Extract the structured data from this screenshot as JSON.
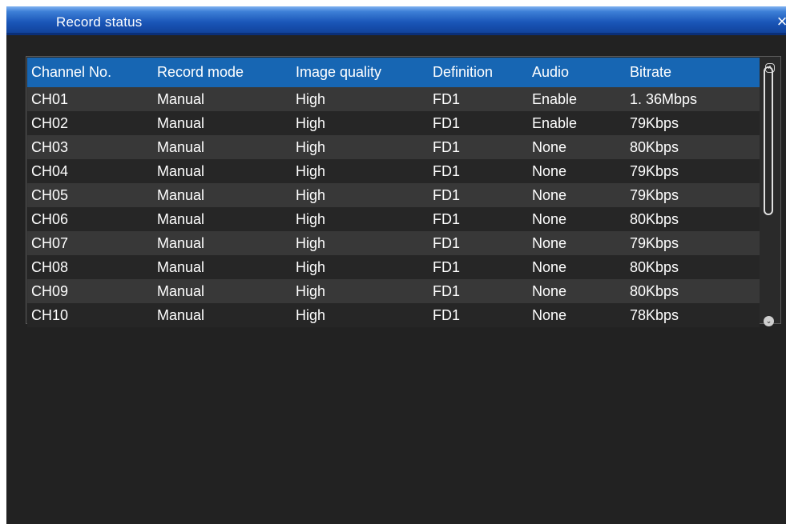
{
  "window": {
    "title": "Record status",
    "close_symbol": "×"
  },
  "table": {
    "headers": [
      "Channel No.",
      "Record mode",
      "Image quality",
      "Definition",
      "Audio",
      "Bitrate"
    ],
    "rows": [
      [
        "CH01",
        "Manual",
        "High",
        "FD1",
        "Enable",
        "1. 36Mbps"
      ],
      [
        "CH02",
        "Manual",
        "High",
        "FD1",
        "Enable",
        "79Kbps"
      ],
      [
        "CH03",
        "Manual",
        "High",
        "FD1",
        "None",
        "80Kbps"
      ],
      [
        "CH04",
        "Manual",
        "High",
        "FD1",
        "None",
        "79Kbps"
      ],
      [
        "CH05",
        "Manual",
        "High",
        "FD1",
        "None",
        "79Kbps"
      ],
      [
        "CH06",
        "Manual",
        "High",
        "FD1",
        "None",
        "80Kbps"
      ],
      [
        "CH07",
        "Manual",
        "High",
        "FD1",
        "None",
        "79Kbps"
      ],
      [
        "CH08",
        "Manual",
        "High",
        "FD1",
        "None",
        "80Kbps"
      ],
      [
        "CH09",
        "Manual",
        "High",
        "FD1",
        "None",
        "80Kbps"
      ],
      [
        "CH10",
        "Manual",
        "High",
        "FD1",
        "None",
        "78Kbps"
      ]
    ]
  },
  "scrollbar": {
    "up_icon": "scroll-up-icon",
    "down_icon": "scroll-down-icon"
  },
  "colors": {
    "title_bar": "#1a56b8",
    "header_row": "#1766b3",
    "background": "#222222"
  }
}
